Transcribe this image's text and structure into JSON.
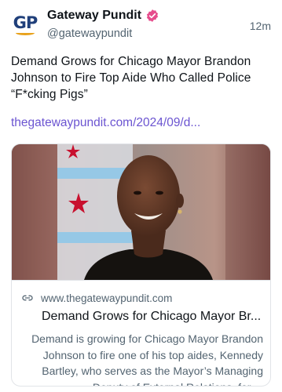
{
  "account": {
    "avatar_text": "GP",
    "display_name": "Gateway Pundit",
    "handle": "@gatewaypundit",
    "timestamp": "12m"
  },
  "post": {
    "text": "Demand Grows for Chicago Mayor Brandon Johnson to Fire Top Aide Who Called Police “F*cking Pigs”",
    "link_text": "thegatewaypundit.com/2024/09/d..."
  },
  "link_card": {
    "domain": "www.thegatewaypundit.com",
    "title": "Demand Grows for Chicago Mayor Br...",
    "description": "Demand is growing for Chicago Mayor Brandon Johnson to fire one of his top aides, Kennedy Bartley, who serves as the Mayor’s Managing Deputy of External Relations, for ..."
  },
  "colors": {
    "link": "#6b54d1",
    "verified": "#e64c8c",
    "avatar_text": "#1f3f7a",
    "avatar_accent": "#e8a21c"
  },
  "icons": {
    "verified": "verified-badge-icon",
    "link": "link-icon"
  }
}
